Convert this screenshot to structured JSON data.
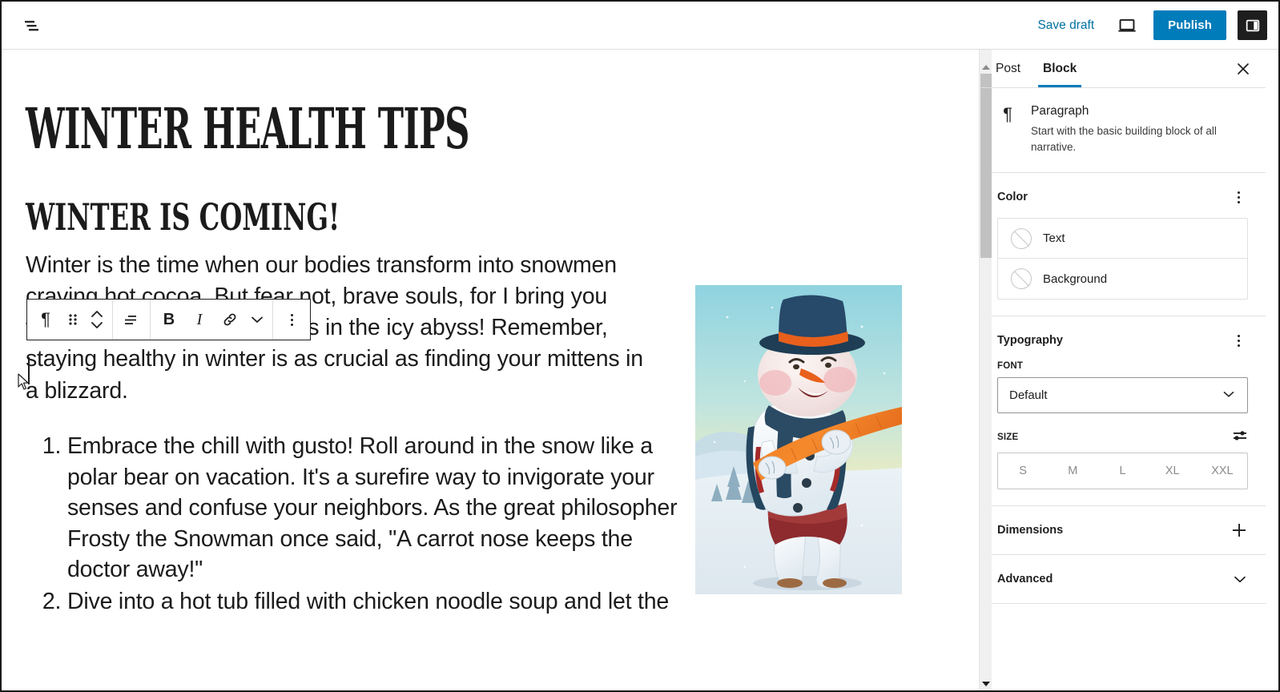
{
  "topbar": {
    "document_tools_icon": "document-tools-icon",
    "save_draft_label": "Save draft",
    "preview_icon": "preview-desktop-icon",
    "publish_label": "Publish",
    "settings_icon": "settings-sidebar-icon",
    "publish_color": "#007cba"
  },
  "block_toolbar": {
    "block_type_icon": "paragraph-icon",
    "block_type_glyph": "¶",
    "drag_handle_icon": "drag-handle-icon",
    "move_updown_icon": "move-up-down-icon",
    "align_icon": "align-text-icon",
    "bold_label": "B",
    "italic_label": "I",
    "link_icon": "link-icon",
    "more_rich_text_icon": "chevron-down-icon",
    "options_icon": "more-options-icon"
  },
  "editor": {
    "title": "WINTER HEALTH TIPS",
    "subheading": "WINTER IS COMING!",
    "paragraph": "Winter is the time when our bodies transform into snowmen craving hot cocoa. But fear not, brave souls, for I bring you tidings of health and wellness in the icy abyss! Remember, staying healthy in winter is as crucial as finding your mittens in a blizzard.",
    "list_items": [
      "Embrace the chill with gusto! Roll around in the snow like a polar bear on vacation. It's a surefire way to invigorate your senses and confuse your neighbors. As the great philosopher Frosty the Snowman once said, \"A carrot nose keeps the doctor away!\"",
      "Dive into a hot tub filled with chicken noodle soup and let the"
    ],
    "image_alt": "snowman-illustration"
  },
  "sidebar": {
    "tabs": [
      {
        "label": "Post",
        "active": false
      },
      {
        "label": "Block",
        "active": true
      }
    ],
    "close_icon": "close-icon",
    "active_tab_color": "#007cba",
    "block_card": {
      "icon": "paragraph-icon",
      "icon_glyph": "¶",
      "name": "Paragraph",
      "description": "Start with the basic building block of all narrative."
    },
    "color": {
      "title": "Color",
      "options_icon": "more-options-icon",
      "rows": [
        {
          "label": "Text",
          "swatch": "none-selected"
        },
        {
          "label": "Background",
          "swatch": "none-selected"
        }
      ]
    },
    "typography": {
      "title": "Typography",
      "options_icon": "more-options-icon",
      "font_label": "FONT",
      "font_value": "Default",
      "font_chevron_icon": "chevron-down-icon",
      "size_label": "SIZE",
      "size_adjust_icon": "settings-sliders-icon",
      "size_options": [
        "S",
        "M",
        "L",
        "XL",
        "XXL"
      ],
      "size_selected": null
    },
    "panels": [
      {
        "label": "Dimensions",
        "action_icon": "plus-icon"
      },
      {
        "label": "Advanced",
        "action_icon": "chevron-down-icon"
      }
    ]
  },
  "scrollbar": {
    "up_arrow_icon": "scroll-up-arrow-icon",
    "down_arrow_icon": "scroll-down-arrow-icon",
    "thumb": "scroll-thumb"
  }
}
